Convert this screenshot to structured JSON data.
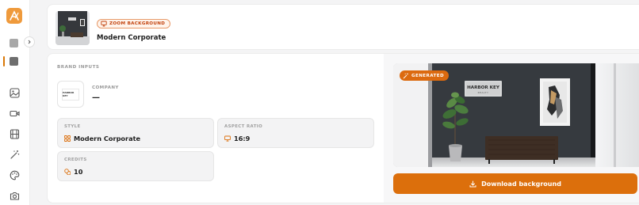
{
  "sidebar": {
    "items": [
      {
        "icon": "square-icon"
      },
      {
        "icon": "square-icon",
        "active": true
      },
      {
        "icon": "image-icon"
      },
      {
        "icon": "video-icon"
      },
      {
        "icon": "film-icon"
      },
      {
        "icon": "magic-wand-icon"
      },
      {
        "icon": "palette-icon"
      },
      {
        "icon": "camera-icon"
      }
    ]
  },
  "header": {
    "tag": "ZOOM BACKGROUND",
    "title": "Modern Corporate"
  },
  "brand": {
    "section_label": "BRAND INPUTS",
    "logo_text": "HARBOR KEY",
    "company_label": "COMPANY",
    "company_value": "—"
  },
  "fields": {
    "style_label": "STYLE",
    "style_value": "Modern Corporate",
    "aspect_label": "ASPECT RATIO",
    "aspect_value": "16:9",
    "credits_label": "CREDITS",
    "credits_value": "10"
  },
  "preview": {
    "badge": "GENERATED",
    "sign_title": "HARBOR KEY",
    "sign_sub": "REALTY",
    "download_label": "Download background"
  },
  "colors": {
    "accent": "#dc6f0c",
    "badge": "#dc6a0f",
    "wall": "#3a3d41"
  }
}
